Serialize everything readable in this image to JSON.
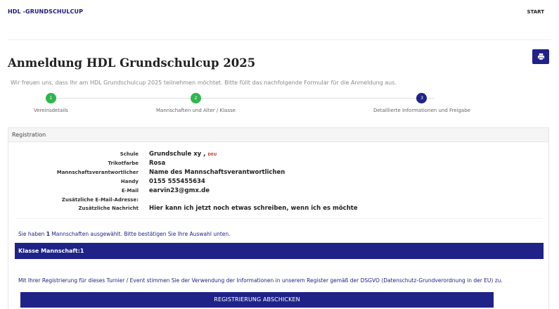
{
  "navbar": {
    "brand": "HDL -GRUNDSCHULCUP",
    "start": "START"
  },
  "header": {
    "title": "Anmeldung HDL Grundschulcup 2025",
    "print_icon": "print-icon"
  },
  "intro": "Wir freuen uns, dass Ihr am HDL Grundschulcup 2025 teilnehmen möchtet. Bitte füllt das nachfolgende Formular für die Anmeldung aus.",
  "steps": [
    {
      "number": "1",
      "label": "Vereinsdetails",
      "color": "#2db84d"
    },
    {
      "number": "2",
      "label": "Mannschaften und Alter / Klasse",
      "color": "#2db84d"
    },
    {
      "number": "3",
      "label": "Detaillierte Informationen und Freigabe",
      "color": "#1f2388"
    }
  ],
  "panel": {
    "title": "Registration",
    "rows": [
      {
        "label": "Schule",
        "value": "Grundschule xy ,",
        "badge": "DEU"
      },
      {
        "label": "Trikotfarbe",
        "value": "Rosa"
      },
      {
        "label": "Mannschaftsverantwortlicher",
        "value": "Name des Mannschaftsverantwortlichen"
      },
      {
        "label": "Handy",
        "value": "0155 555455634"
      },
      {
        "label": "E-Mail",
        "value": "earvin23@gmx.de"
      },
      {
        "label": "Zusätzliche E-Mail-Adresse:",
        "value": ""
      },
      {
        "label": "Zusätzliche Nachricht",
        "value": "Hier kann ich jetzt noch etwas schreiben, wenn ich es möchte"
      }
    ],
    "selected_pre": "Sie haben ",
    "selected_count": "1",
    "selected_post": " Mannschaften ausgewählt. Bitte bestätigen Sie Ihre Auswahl unten.",
    "class_bar": "Klasse Mannschaft:1",
    "consent": "Mit Ihrer Registrierung für dieses Turnier / Event stimmen Sie der Verwendung der Informationen in unserem Register gemäß der DSGVO (Datenschutz-Grundverordnung in der EU) zu.",
    "submit": "REGISTRIERUNG ABSCHICKEN"
  },
  "colors": {
    "primary": "#1f2388",
    "step_done": "#2db84d",
    "badge": "#c0392b"
  }
}
